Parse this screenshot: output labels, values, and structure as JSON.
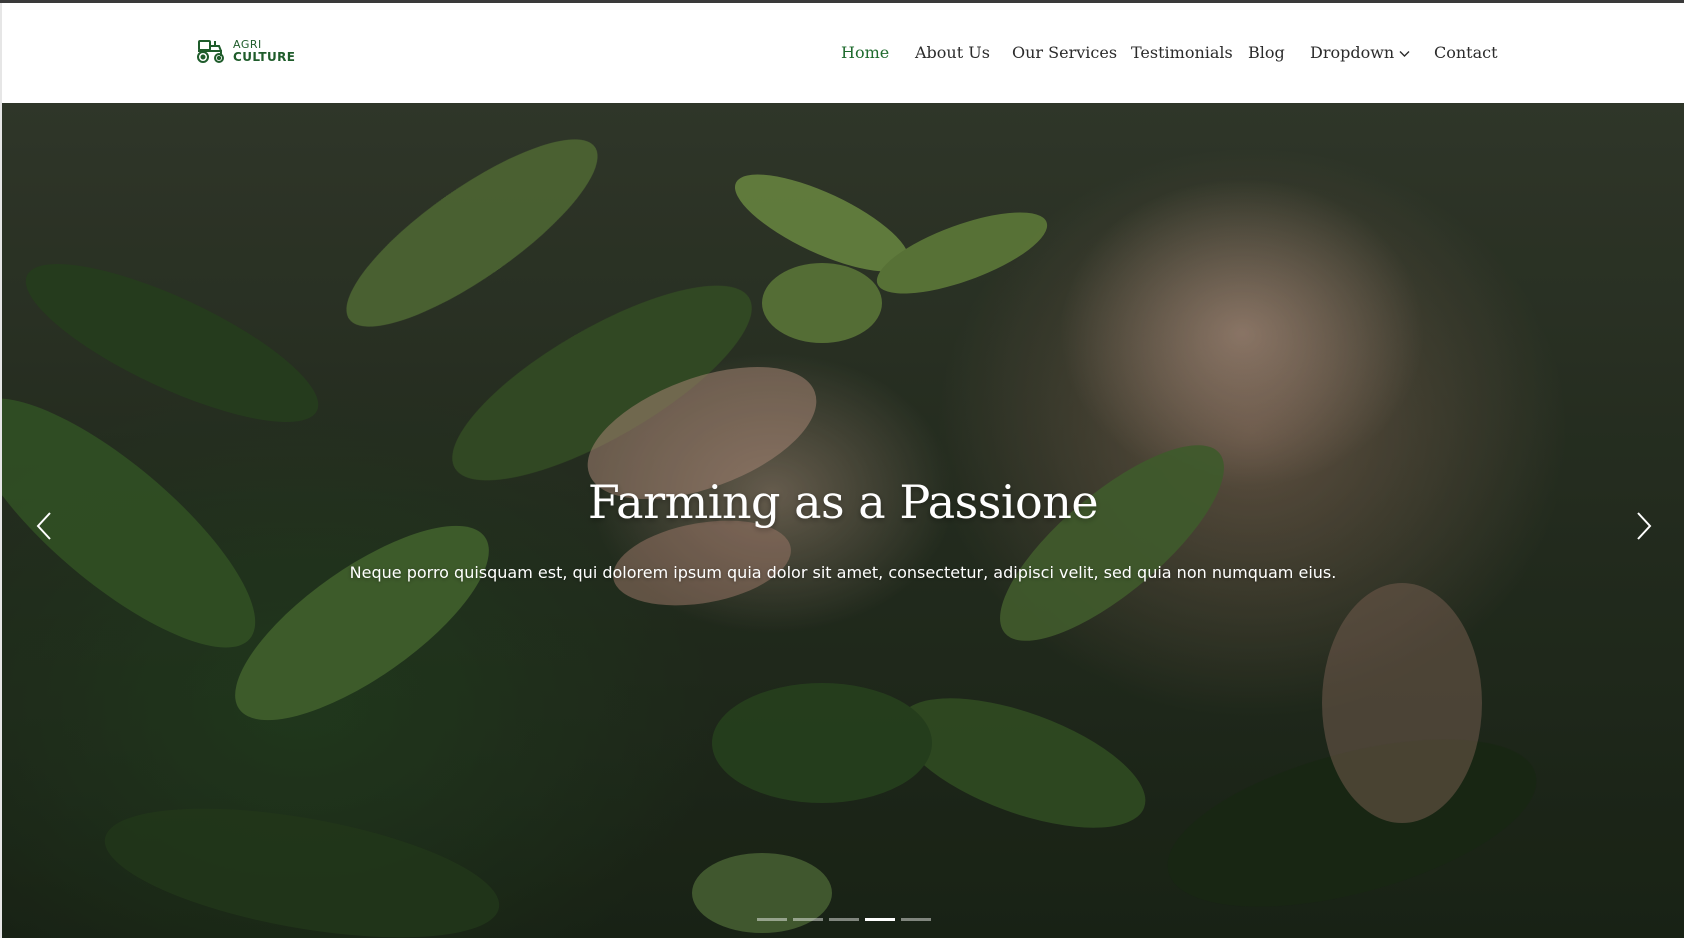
{
  "logo": {
    "line1": "AGRI",
    "line2": "CULTURE",
    "icon": "tractor-icon",
    "color": "#1f5c2b"
  },
  "nav": {
    "items": [
      {
        "label": "Home",
        "active": true
      },
      {
        "label": "About Us"
      },
      {
        "label": "Our Services"
      },
      {
        "label": "Testimonials"
      },
      {
        "label": "Blog"
      },
      {
        "label": "Dropdown",
        "icon": "chevron-down-icon"
      },
      {
        "label": "Contact"
      }
    ],
    "active_color": "#1f6b2e"
  },
  "hero": {
    "title": "Farming as a Passione",
    "subtitle": "Neque porro quisquam est, qui dolorem ipsum quia dolor sit amet, consectetur, adipisci velit, sed quia non numquam eius.",
    "prev_icon": "chevron-left-icon",
    "next_icon": "chevron-right-icon",
    "slides_total": 5,
    "active_slide": 4
  }
}
